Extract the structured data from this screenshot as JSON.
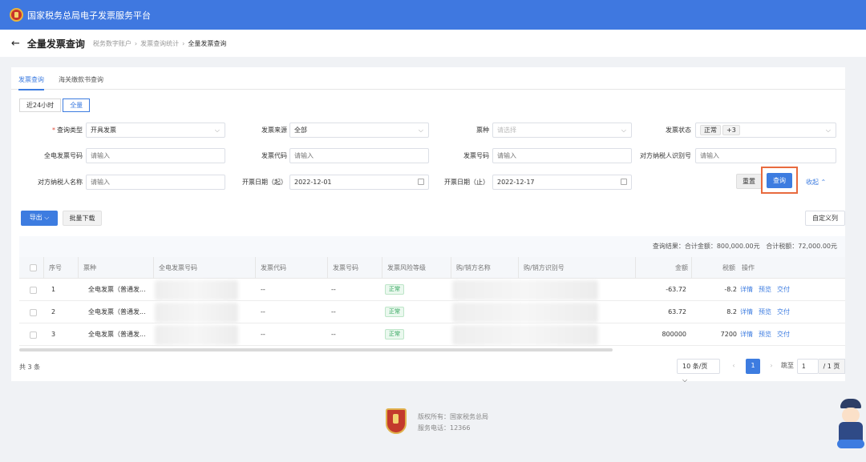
{
  "app": {
    "title": "国家税务总局电子发票服务平台"
  },
  "header": {
    "back_icon": "arrow-left-icon",
    "page_title": "全量发票查询",
    "breadcrumb": [
      "税务数字账户",
      "发票查询统计",
      "全量发票查询"
    ]
  },
  "tabs": [
    {
      "label": "发票查询",
      "active": true
    },
    {
      "label": "海关缴款书查询",
      "active": false
    }
  ],
  "range": {
    "options": [
      "近24小时",
      "全量"
    ],
    "selected": "全量"
  },
  "filters": {
    "query_type": {
      "label": "查询类型",
      "value": "开具发票"
    },
    "invoice_source": {
      "label": "发票来源",
      "value": "全部"
    },
    "ticket_type": {
      "label": "票种",
      "placeholder": "请选择"
    },
    "invoice_status": {
      "label": "发票状态",
      "tag": "正常",
      "more": "+3"
    },
    "full_invoice_no": {
      "label": "全电发票号码",
      "placeholder": "请输入"
    },
    "invoice_code": {
      "label": "发票代码",
      "placeholder": "请输入"
    },
    "invoice_no": {
      "label": "发票号码",
      "placeholder": "请输入"
    },
    "counterparty_tax_id": {
      "label": "对方纳税人识别号",
      "placeholder": "请输入"
    },
    "counterparty_name": {
      "label": "对方纳税人名称",
      "placeholder": "请输入"
    },
    "date_start": {
      "label": "开票日期（起）",
      "value": "2022-12-01"
    },
    "date_end": {
      "label": "开票日期（止）",
      "value": "2022-12-17"
    }
  },
  "actions": {
    "reset": "重置",
    "query": "查询",
    "collapse": "收起"
  },
  "toolbar": {
    "export": "导出",
    "batch_download": "批量下载",
    "custom_columns": "自定义列"
  },
  "summary": {
    "text": "查询结果：",
    "amount_label": "合计金额：",
    "amount": "800,000.00元",
    "tax_label": "合计税额：",
    "tax": "72,000.00元"
  },
  "table": {
    "columns": [
      "序号",
      "票种",
      "全电发票号码",
      "发票代码",
      "发票号码",
      "发票风险等级",
      "购/销方名称",
      "购/销方识别号",
      "金额",
      "税额",
      "操作"
    ],
    "rows": [
      {
        "no": "1",
        "type": "全电发票（普通发...",
        "code": "--",
        "num": "--",
        "risk": "正常",
        "amount": "-63.72",
        "tax": "-8.2"
      },
      {
        "no": "2",
        "type": "全电发票（普通发...",
        "code": "--",
        "num": "--",
        "risk": "正常",
        "amount": "63.72",
        "tax": "8.2"
      },
      {
        "no": "3",
        "type": "全电发票（普通发...",
        "code": "--",
        "num": "--",
        "risk": "正常",
        "amount": "800000",
        "tax": "7200"
      }
    ],
    "ops": [
      "详情",
      "预览",
      "交付"
    ]
  },
  "pagination": {
    "total": "共 3 条",
    "page_size": "10 条/页",
    "current": "1",
    "goto_label": "跳至",
    "goto_value": "1",
    "page_count": "/ 1 页"
  },
  "footer": {
    "copyright": "版权所有：国家税务总局",
    "phone": "服务电话：12366"
  },
  "colors": {
    "primary": "#3d7ce0",
    "header": "#3f78e0",
    "highlight": "#e86a3e",
    "success": "#2fa45a"
  }
}
